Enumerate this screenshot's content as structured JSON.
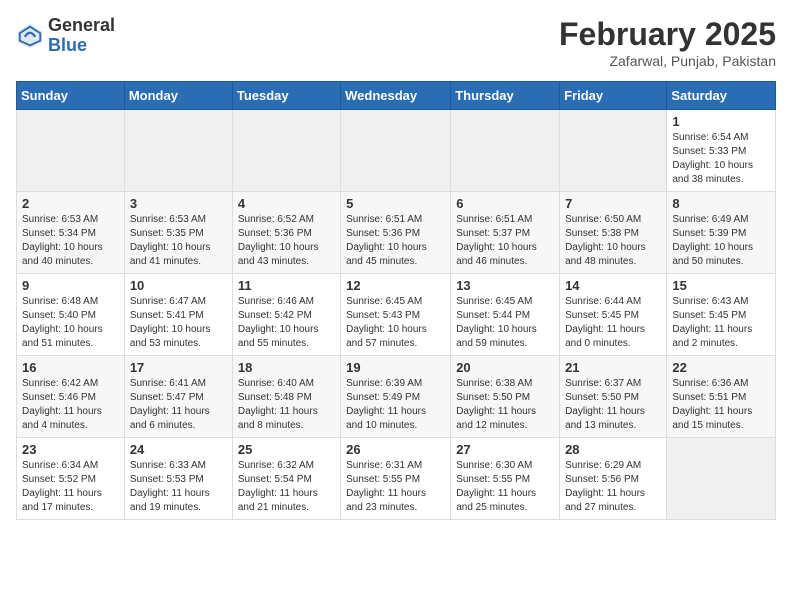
{
  "header": {
    "logo_general": "General",
    "logo_blue": "Blue",
    "title": "February 2025",
    "subtitle": "Zafarwal, Punjab, Pakistan"
  },
  "calendar": {
    "days_of_week": [
      "Sunday",
      "Monday",
      "Tuesday",
      "Wednesday",
      "Thursday",
      "Friday",
      "Saturday"
    ],
    "weeks": [
      [
        {
          "day": "",
          "info": ""
        },
        {
          "day": "",
          "info": ""
        },
        {
          "day": "",
          "info": ""
        },
        {
          "day": "",
          "info": ""
        },
        {
          "day": "",
          "info": ""
        },
        {
          "day": "",
          "info": ""
        },
        {
          "day": "1",
          "info": "Sunrise: 6:54 AM\nSunset: 5:33 PM\nDaylight: 10 hours and 38 minutes."
        }
      ],
      [
        {
          "day": "2",
          "info": "Sunrise: 6:53 AM\nSunset: 5:34 PM\nDaylight: 10 hours and 40 minutes."
        },
        {
          "day": "3",
          "info": "Sunrise: 6:53 AM\nSunset: 5:35 PM\nDaylight: 10 hours and 41 minutes."
        },
        {
          "day": "4",
          "info": "Sunrise: 6:52 AM\nSunset: 5:36 PM\nDaylight: 10 hours and 43 minutes."
        },
        {
          "day": "5",
          "info": "Sunrise: 6:51 AM\nSunset: 5:36 PM\nDaylight: 10 hours and 45 minutes."
        },
        {
          "day": "6",
          "info": "Sunrise: 6:51 AM\nSunset: 5:37 PM\nDaylight: 10 hours and 46 minutes."
        },
        {
          "day": "7",
          "info": "Sunrise: 6:50 AM\nSunset: 5:38 PM\nDaylight: 10 hours and 48 minutes."
        },
        {
          "day": "8",
          "info": "Sunrise: 6:49 AM\nSunset: 5:39 PM\nDaylight: 10 hours and 50 minutes."
        }
      ],
      [
        {
          "day": "9",
          "info": "Sunrise: 6:48 AM\nSunset: 5:40 PM\nDaylight: 10 hours and 51 minutes."
        },
        {
          "day": "10",
          "info": "Sunrise: 6:47 AM\nSunset: 5:41 PM\nDaylight: 10 hours and 53 minutes."
        },
        {
          "day": "11",
          "info": "Sunrise: 6:46 AM\nSunset: 5:42 PM\nDaylight: 10 hours and 55 minutes."
        },
        {
          "day": "12",
          "info": "Sunrise: 6:45 AM\nSunset: 5:43 PM\nDaylight: 10 hours and 57 minutes."
        },
        {
          "day": "13",
          "info": "Sunrise: 6:45 AM\nSunset: 5:44 PM\nDaylight: 10 hours and 59 minutes."
        },
        {
          "day": "14",
          "info": "Sunrise: 6:44 AM\nSunset: 5:45 PM\nDaylight: 11 hours and 0 minutes."
        },
        {
          "day": "15",
          "info": "Sunrise: 6:43 AM\nSunset: 5:45 PM\nDaylight: 11 hours and 2 minutes."
        }
      ],
      [
        {
          "day": "16",
          "info": "Sunrise: 6:42 AM\nSunset: 5:46 PM\nDaylight: 11 hours and 4 minutes."
        },
        {
          "day": "17",
          "info": "Sunrise: 6:41 AM\nSunset: 5:47 PM\nDaylight: 11 hours and 6 minutes."
        },
        {
          "day": "18",
          "info": "Sunrise: 6:40 AM\nSunset: 5:48 PM\nDaylight: 11 hours and 8 minutes."
        },
        {
          "day": "19",
          "info": "Sunrise: 6:39 AM\nSunset: 5:49 PM\nDaylight: 11 hours and 10 minutes."
        },
        {
          "day": "20",
          "info": "Sunrise: 6:38 AM\nSunset: 5:50 PM\nDaylight: 11 hours and 12 minutes."
        },
        {
          "day": "21",
          "info": "Sunrise: 6:37 AM\nSunset: 5:50 PM\nDaylight: 11 hours and 13 minutes."
        },
        {
          "day": "22",
          "info": "Sunrise: 6:36 AM\nSunset: 5:51 PM\nDaylight: 11 hours and 15 minutes."
        }
      ],
      [
        {
          "day": "23",
          "info": "Sunrise: 6:34 AM\nSunset: 5:52 PM\nDaylight: 11 hours and 17 minutes."
        },
        {
          "day": "24",
          "info": "Sunrise: 6:33 AM\nSunset: 5:53 PM\nDaylight: 11 hours and 19 minutes."
        },
        {
          "day": "25",
          "info": "Sunrise: 6:32 AM\nSunset: 5:54 PM\nDaylight: 11 hours and 21 minutes."
        },
        {
          "day": "26",
          "info": "Sunrise: 6:31 AM\nSunset: 5:55 PM\nDaylight: 11 hours and 23 minutes."
        },
        {
          "day": "27",
          "info": "Sunrise: 6:30 AM\nSunset: 5:55 PM\nDaylight: 11 hours and 25 minutes."
        },
        {
          "day": "28",
          "info": "Sunrise: 6:29 AM\nSunset: 5:56 PM\nDaylight: 11 hours and 27 minutes."
        },
        {
          "day": "",
          "info": ""
        }
      ]
    ]
  }
}
